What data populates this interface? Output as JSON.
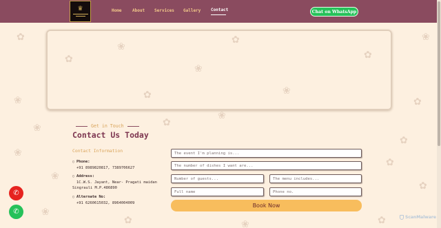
{
  "header": {
    "logo_icon": "logo-crest",
    "nav": [
      {
        "label": "Home",
        "active": false
      },
      {
        "label": "About",
        "active": false
      },
      {
        "label": "Services",
        "active": false
      },
      {
        "label": "Gallery",
        "active": false
      },
      {
        "label": "Contact",
        "active": true
      }
    ],
    "whatsapp_label": "Chat on WhatsApp"
  },
  "section": {
    "eyebrow": "Get in Touch",
    "title": "Contact Us Today",
    "info_heading": "Contact Information",
    "phone_label": "Phone:",
    "phone_value": "+91 8989820817, 7389706627",
    "address_label": "Address:",
    "address_line1": "1C.W.S. Jayant, Near- Pragati maidan",
    "address_line2": "Singrauli M.P.486890",
    "alt_label": "Alternate No:",
    "alt_value": "+91 6260615032, 8964004009"
  },
  "form": {
    "event_placeholder": "The event I'm planning is...",
    "dishes_placeholder": "The number of dishes I want are...",
    "guests_placeholder": "Number of guests...",
    "menu_placeholder": "The menu includes...",
    "name_placeholder": "Full name",
    "phone_placeholder": "Phone no.",
    "submit_label": "Book Now"
  },
  "floating": {
    "call_icon": "phone-icon",
    "whatsapp_icon": "whatsapp-icon"
  },
  "watermark": "ScanMalware",
  "colors": {
    "header_bg": "#8a4b5f",
    "page_bg": "#fdf0e0",
    "accent_gold": "#f8bd5d",
    "title": "#7d3650",
    "whatsapp_green": "#26c15a",
    "call_red": "#e6231f"
  }
}
